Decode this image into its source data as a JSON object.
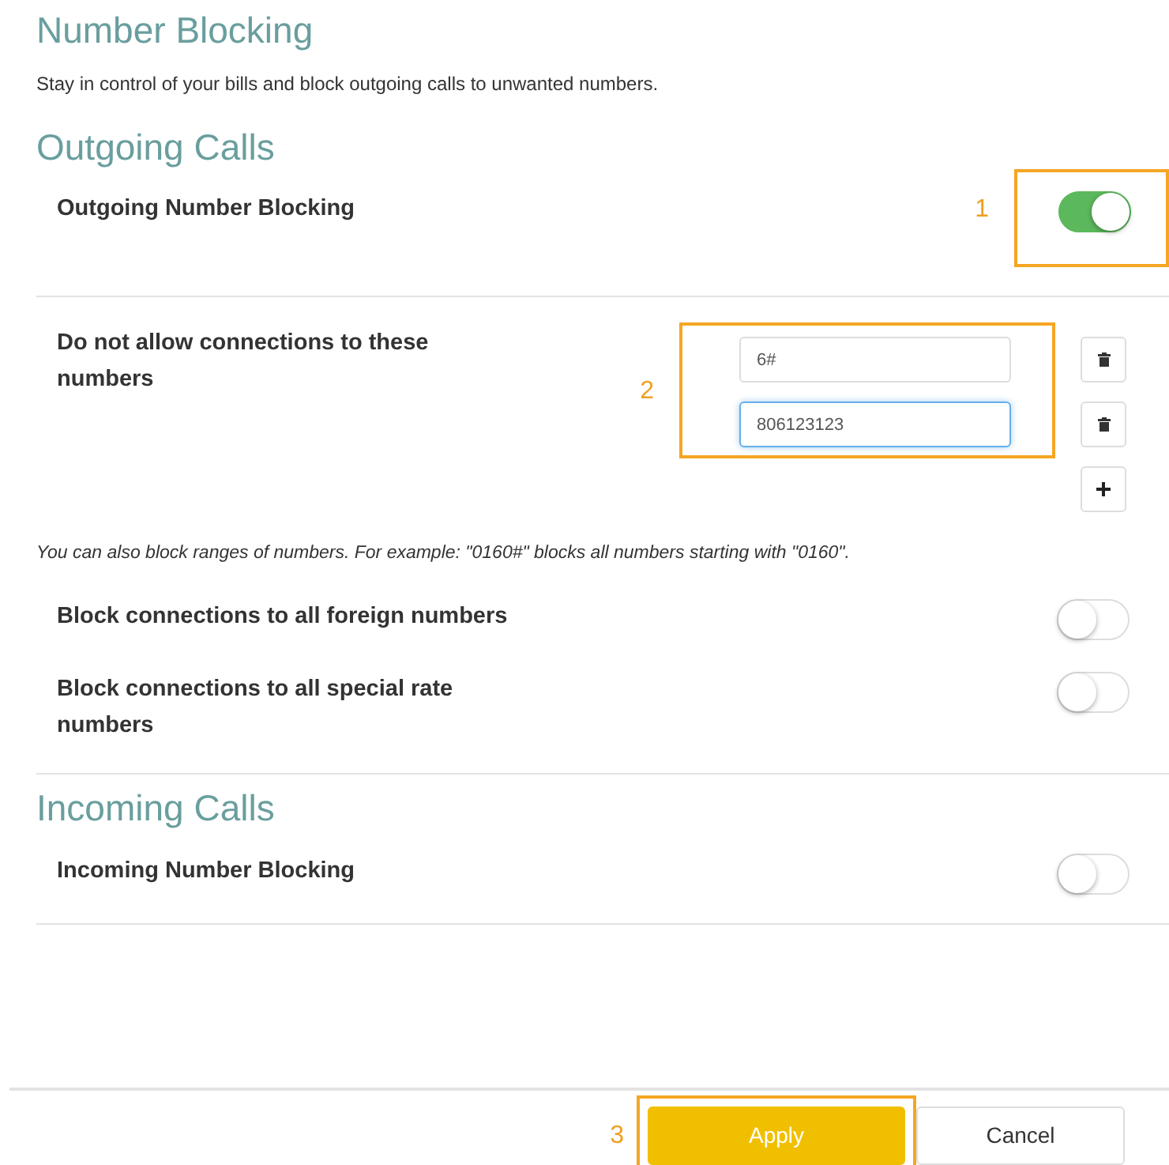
{
  "title": "Number Blocking",
  "description": "Stay in control of your bills and block outgoing calls to unwanted numbers.",
  "sections": [
    {
      "heading": "Outgoing Calls",
      "rows": [
        {
          "kind": "toggle",
          "label": "Outgoing Number Blocking",
          "on": true,
          "callout": "1"
        },
        {
          "kind": "numbers",
          "label": "Do not allow connections to these numbers",
          "callout": "2",
          "numbers": [
            {
              "value": "6#",
              "focused": false
            },
            {
              "value": "806123123",
              "focused": true
            }
          ]
        },
        {
          "kind": "hint",
          "text": "You can also block ranges of numbers. For example: \"0160#\" blocks all numbers starting with \"0160\"."
        },
        {
          "kind": "toggle",
          "label": "Block connections to all foreign numbers",
          "on": false
        },
        {
          "kind": "toggle",
          "label": "Block connections to all special rate numbers",
          "on": false
        }
      ]
    },
    {
      "heading": "Incoming Calls",
      "rows": [
        {
          "kind": "toggle",
          "label": "Incoming Number Blocking",
          "on": false
        }
      ]
    }
  ],
  "buttons": [
    {
      "label": "Apply",
      "kind": "primary",
      "callout": "3"
    },
    {
      "label": "Cancel",
      "kind": "secondary"
    }
  ]
}
